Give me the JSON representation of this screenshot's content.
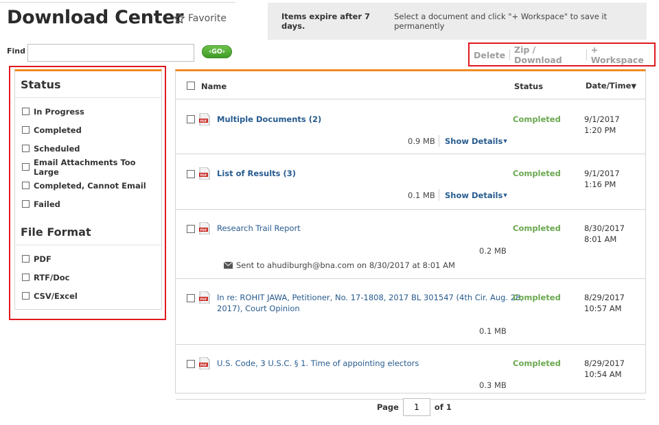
{
  "header": {
    "title": "Download Center",
    "favorite_label": "Favorite",
    "notice_bold": "Items expire after 7 days.",
    "notice_text": "Select a document and click \"+ Workspace\" to save it permanently"
  },
  "search": {
    "label": "Find",
    "value": "",
    "placeholder": "",
    "go_label": "GO"
  },
  "actions": {
    "delete": "Delete",
    "zip_download": "Zip / Download",
    "workspace": "+ Workspace"
  },
  "filters": {
    "status_title": "Status",
    "status_options": [
      "In Progress",
      "Completed",
      "Scheduled",
      "Email Attachments Too Large",
      "Completed, Cannot Email",
      "Failed"
    ],
    "format_title": "File Format",
    "format_options": [
      "PDF",
      "RTF/Doc",
      "CSV/Excel"
    ]
  },
  "table": {
    "columns": {
      "name": "Name",
      "status": "Status",
      "date": "Date/Time"
    },
    "sort_indicator": "▼",
    "rows": [
      {
        "name": "Multiple Documents (2)",
        "status": "Completed",
        "date": "9/1/2017",
        "time": "1:20 PM",
        "size": "0.9 MB",
        "details": "Show Details"
      },
      {
        "name": "List of Results (3)",
        "status": "Completed",
        "date": "9/1/2017",
        "time": "1:16 PM",
        "size": "0.1 MB",
        "details": "Show Details"
      },
      {
        "name": "Research Trail Report",
        "status": "Completed",
        "date": "8/30/2017",
        "time": "8:01 AM",
        "size": "0.2 MB",
        "sent": "Sent to ahudiburgh@bna.com on 8/30/2017 at 8:01 AM"
      },
      {
        "name_line1": "In re: ROHIT JAWA, Petitioner, No. 17-1808, 2017 BL 301547 (4th Cir. Aug. 28,",
        "name_line2": "2017), Court Opinion",
        "status": "Completed",
        "date": "8/29/2017",
        "time": "10:57 AM",
        "size": "0.1 MB"
      },
      {
        "name": "U.S. Code, 3 U.S.C. § 1. Time of appointing electors",
        "status": "Completed",
        "date": "8/29/2017",
        "time": "10:54 AM",
        "size": "0.3 MB"
      }
    ]
  },
  "pager": {
    "label": "Page",
    "current": "1",
    "of_label": "of 1"
  },
  "icons": {
    "file": "pdf-file-icon",
    "favorite": "star-outline-icon",
    "sent": "envelope-icon"
  },
  "colors": {
    "accent": "#f08a24",
    "link": "#275b8f",
    "status_completed": "#6aa84f",
    "highlight": "#e0171f",
    "go_button": "#4caf2f"
  }
}
